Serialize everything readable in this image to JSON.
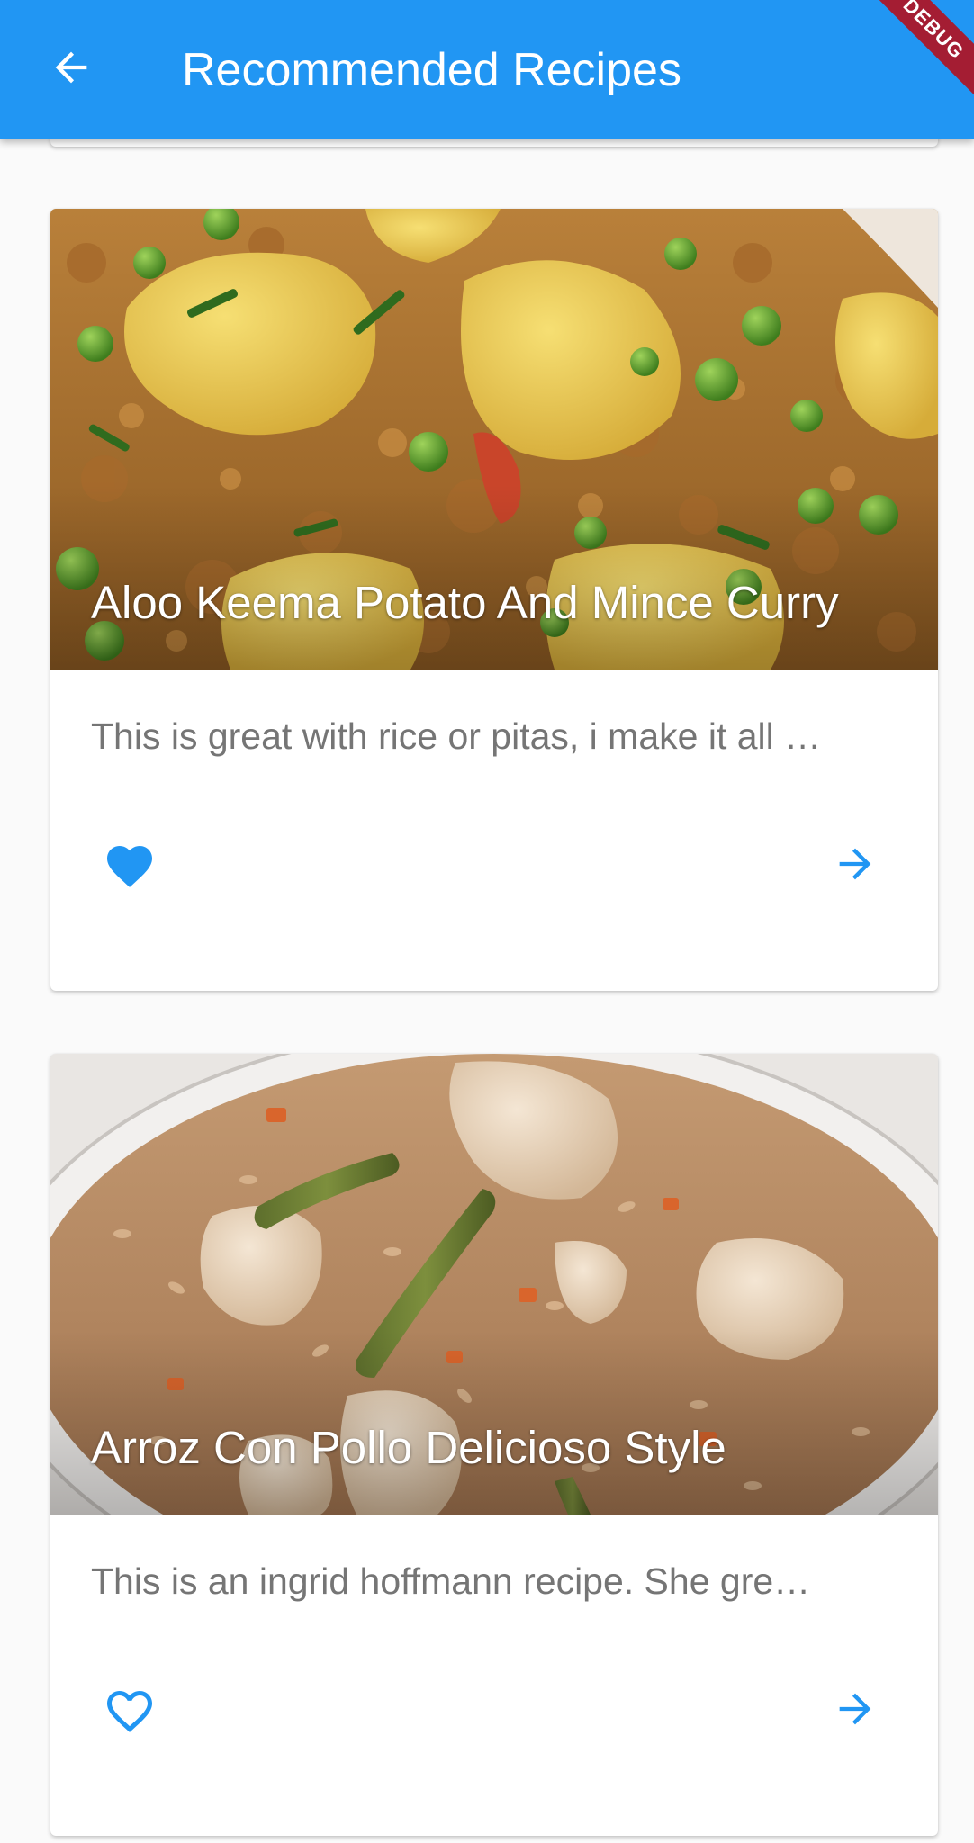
{
  "appbar": {
    "title": "Recommended Recipes",
    "back_icon": "arrow-back-icon",
    "background_color": "#2196F3",
    "debug_banner": "DEBUG"
  },
  "recipes": [
    {
      "title": "Aloo Keema Potato And Mince Curry",
      "description": "This is great with rice or pitas, i make it all …",
      "favorited": true,
      "favorite_icon": "heart-filled-icon",
      "open_icon": "arrow-forward-icon"
    },
    {
      "title": "Arroz Con Pollo Delicioso Style",
      "description": "This is an ingrid hoffmann recipe.  She gre…",
      "favorited": false,
      "favorite_icon": "heart-outline-icon",
      "open_icon": "arrow-forward-icon"
    }
  ],
  "colors": {
    "accent": "#2196F3",
    "description_text": "#757575",
    "title_text": "#FFFFFF"
  }
}
